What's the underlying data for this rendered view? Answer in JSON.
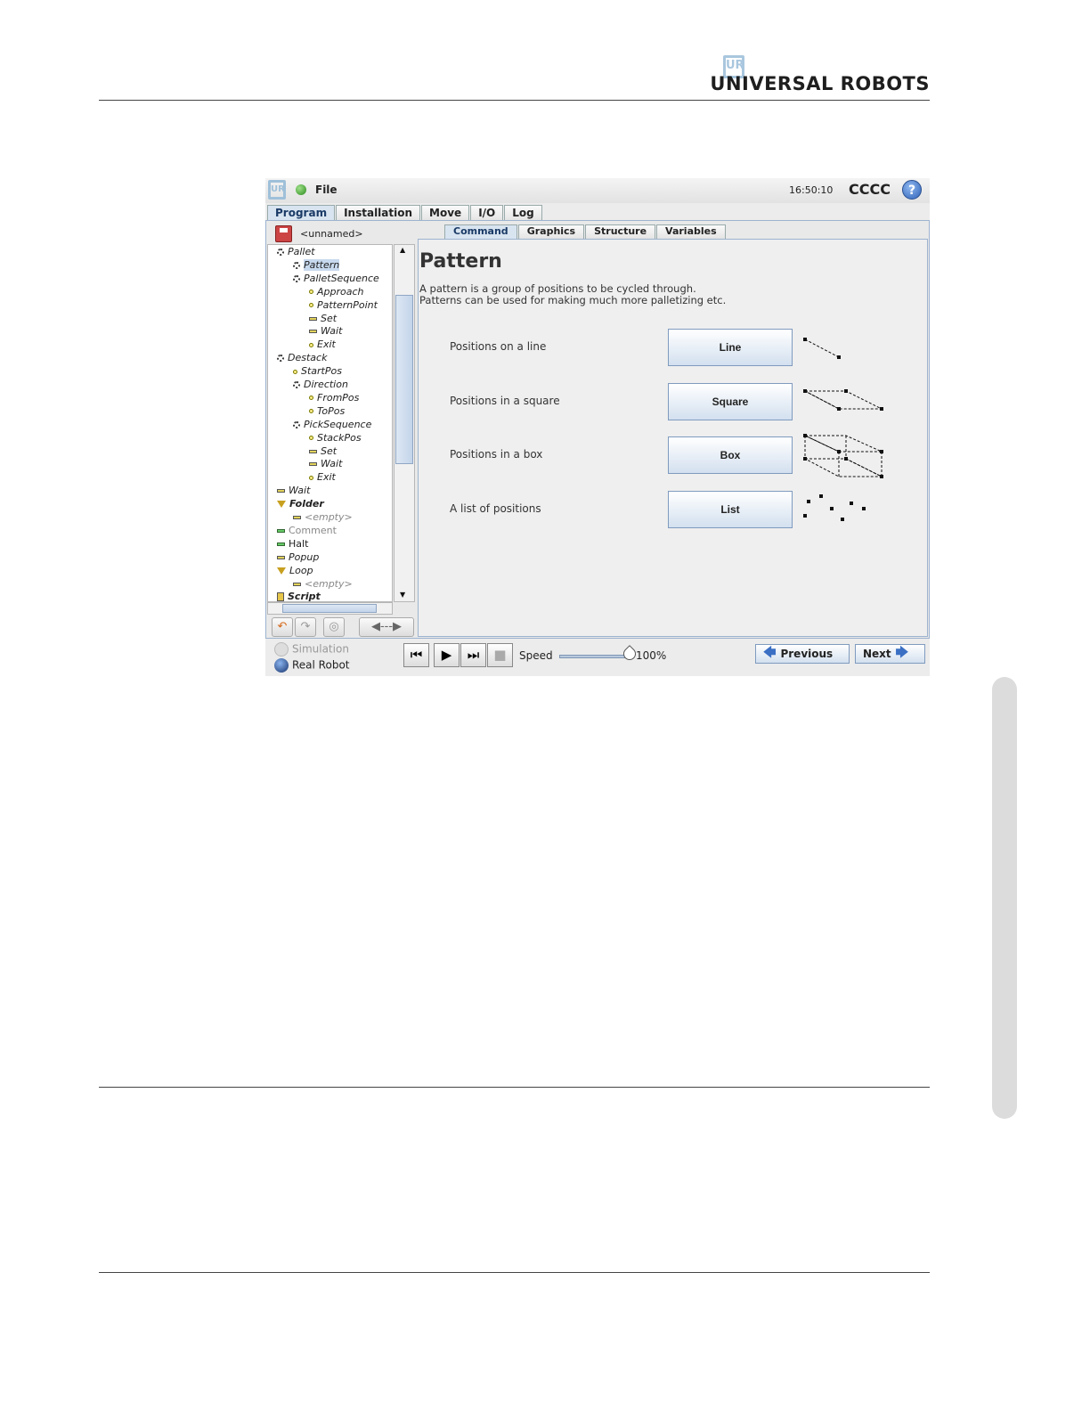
{
  "brand": {
    "logo": "UR",
    "name": "UNIVERSAL ROBOTS"
  },
  "topbar": {
    "logo": "UR",
    "file_menu": "File",
    "clock": "16:50:10",
    "robot_name": "CCCC",
    "help": "?"
  },
  "main_tabs": [
    "Program",
    "Installation",
    "Move",
    "I/O",
    "Log"
  ],
  "program_name": "<unnamed>",
  "tree": [
    {
      "label": "Pallet",
      "indent": 0,
      "marker": "grp",
      "style": "it"
    },
    {
      "label": "Pattern",
      "indent": 1,
      "marker": "grp",
      "style": "it sel"
    },
    {
      "label": "PalletSequence",
      "indent": 1,
      "marker": "grp",
      "style": "it"
    },
    {
      "label": "Approach",
      "indent": 2,
      "marker": "pt",
      "style": "it"
    },
    {
      "label": "PatternPoint",
      "indent": 2,
      "marker": "pt",
      "style": "it"
    },
    {
      "label": "Set",
      "indent": 2,
      "marker": "bar",
      "style": "it"
    },
    {
      "label": "Wait",
      "indent": 2,
      "marker": "bar",
      "style": "it"
    },
    {
      "label": "Exit",
      "indent": 2,
      "marker": "pt",
      "style": "it"
    },
    {
      "label": "Destack",
      "indent": 0,
      "marker": "grp",
      "style": "it"
    },
    {
      "label": "StartPos",
      "indent": 1,
      "marker": "pt",
      "style": "it"
    },
    {
      "label": "Direction",
      "indent": 1,
      "marker": "grp",
      "style": "it"
    },
    {
      "label": "FromPos",
      "indent": 2,
      "marker": "pt",
      "style": "it"
    },
    {
      "label": "ToPos",
      "indent": 2,
      "marker": "pt",
      "style": "it"
    },
    {
      "label": "PickSequence",
      "indent": 1,
      "marker": "grp",
      "style": "it"
    },
    {
      "label": "StackPos",
      "indent": 2,
      "marker": "pt",
      "style": "it"
    },
    {
      "label": "Set",
      "indent": 2,
      "marker": "bar",
      "style": "it"
    },
    {
      "label": "Wait",
      "indent": 2,
      "marker": "bar",
      "style": "it"
    },
    {
      "label": "Exit",
      "indent": 2,
      "marker": "pt",
      "style": "it"
    },
    {
      "label": "Wait",
      "indent": 0,
      "marker": "bar",
      "style": "it"
    },
    {
      "label": "Folder",
      "indent": 0,
      "marker": "tri",
      "style": "it b"
    },
    {
      "label": "<empty>",
      "indent": 1,
      "marker": "bar",
      "style": "it gray"
    },
    {
      "label": "Comment",
      "indent": 0,
      "marker": "gbar",
      "style": "gray"
    },
    {
      "label": "Halt",
      "indent": 0,
      "marker": "gbar",
      "style": ""
    },
    {
      "label": "Popup",
      "indent": 0,
      "marker": "bar",
      "style": "it"
    },
    {
      "label": "Loop",
      "indent": 0,
      "marker": "tri",
      "style": "it"
    },
    {
      "label": "<empty>",
      "indent": 1,
      "marker": "bar",
      "style": "it gray"
    },
    {
      "label": "Script",
      "indent": 0,
      "marker": "scr",
      "style": "it b"
    }
  ],
  "sub_tabs": [
    "Command",
    "Graphics",
    "Structure",
    "Variables"
  ],
  "panel": {
    "title": "Pattern",
    "desc_line1": "A pattern is a group of positions to be cycled through.",
    "desc_line2": "Patterns can be used for making much more palletizing etc."
  },
  "options": [
    {
      "label": "Positions on a line",
      "button": "Line"
    },
    {
      "label": "Positions in a square",
      "button": "Square"
    },
    {
      "label": "Positions in a box",
      "button": "Box"
    },
    {
      "label": "A list of positions",
      "button": "List"
    }
  ],
  "bottom": {
    "simulation": "Simulation",
    "real_robot": "Real Robot",
    "speed_label": "Speed",
    "speed_value": "100%",
    "speed_fraction": 1.0,
    "previous": "Previous",
    "next": "Next"
  }
}
